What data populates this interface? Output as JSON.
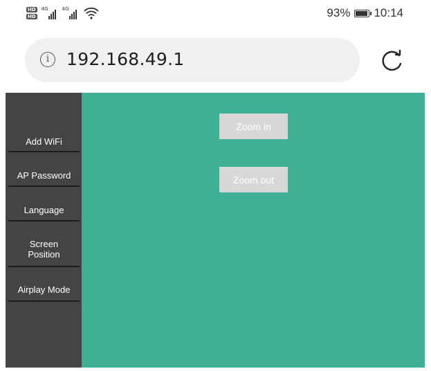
{
  "status_bar": {
    "hd_1": "HD",
    "hd_2": "HD",
    "network_1": "4G",
    "network_2": "4G",
    "battery_percent": "93%",
    "battery_level": 0.93,
    "time": "10:14",
    "icons": [
      "hd-icon",
      "signal-icon",
      "wifi-icon",
      "battery-icon"
    ]
  },
  "address_bar": {
    "url": "192.168.49.1",
    "icons": [
      "info-icon",
      "reload-icon"
    ]
  },
  "sidebar": {
    "items": [
      {
        "label": "Add WiFi"
      },
      {
        "label": "AP Password"
      },
      {
        "label": "Language"
      },
      {
        "label": "Screen\nPosition"
      },
      {
        "label": "Airplay Mode"
      }
    ]
  },
  "main": {
    "zoom_in_label": "Zoom in",
    "zoom_out_label": "Zoom out"
  },
  "colors": {
    "sidebar_bg": "#444444",
    "main_bg": "#3eb194",
    "button_bg": "#d8d8d8",
    "urlbar_bg": "#f0f0f0"
  }
}
